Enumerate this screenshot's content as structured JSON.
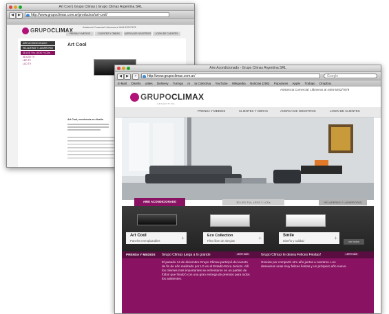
{
  "back_window": {
    "title": "Art Cool | Grupo Climax | Grupo Climax Argentina SRL",
    "url": "http://www.grupoclimax.com.ar/productos/art-cool/",
    "logo_prefix": "GRUPO",
    "logo_suffix": "CLIMAX",
    "nav": [
      "PRENSA Y MEDIOS",
      "CLIENTES Y OBRAS",
      "ACERCA DE NOSOTROS",
      "LOGIN DE CLIENTES"
    ],
    "phone": "Asistencia Comercial: Llámenos al 4464-5202/7678",
    "sidebar": [
      "AIRE ACONDICIONADO",
      "HELADERAS Y LAVARROPAS",
      "3D LED TVs, LEDS Y LCDs",
      "3D LED TV",
      "LED TV",
      "LCD TV"
    ],
    "product_title": "Art Cool",
    "product_subtitle": "Art Cool, excelencia en diseño"
  },
  "front_window": {
    "title": "Aire Acondicionado - Grupo Climax Argentina SRL",
    "url": "http://www.grupoclimax.com.ar/",
    "search_placeholder": "Google",
    "bookmarks": [
      "E-Mail",
      "Diseño",
      "utiles",
      "Delivery",
      "Turingo",
      "m",
      "la Colectiva",
      "YouTube",
      "Wikipedia",
      "Noticias (256)",
      "Populares",
      "Apple",
      "Trabajo",
      "Dropbox"
    ],
    "logo_prefix": "GRUPO",
    "logo_suffix": "CLIMAX",
    "logo_tagline": "ARGENTINA",
    "phone": "Asistencia Comercial: Llámenos al 4464-5202/7678",
    "nav": [
      "PRENSA Y MEDIOS",
      "CLIENTES Y OBRAS",
      "ACERCA DE NOSOTROS",
      "LOGIN DE CLIENTES"
    ],
    "category_tabs": [
      "AIRE ACONDICIONADO",
      "3D LED TVs, LEDS Y LCDs",
      "HELADERAS Y LAVARROPAS"
    ],
    "products": [
      {
        "name": "Art Cool",
        "desc": "Paneles reemplazables"
      },
      {
        "name": "Eco Collection",
        "desc": "Filtro libre de alergias"
      },
      {
        "name": "Smile",
        "desc": "Diseño y calidad"
      }
    ],
    "ver_todos": "ver todos",
    "news_section": "PRENSA Y MEDIOS",
    "news": [
      {
        "headline": "Grupo Climax juega a lo grande",
        "leer": "LEER MÁS",
        "body": "El pasado 14 de diciembre Grupo Climax participó del evento de fin de año realizado por LG en el Estadio Boca Juniors. Allí los clientes más importantes se enfrentaron en un partido de fútbol que finalizó con una gran entrega de premios para todos los asistentes."
      },
      {
        "headline": "Grupo Climax le desea Felices Fiestas!",
        "leer": "LEER MÁS",
        "body": "Gracias por compartir otro año juntos a nosotros. Les deseamos unas muy felices fiestas y un próspero año nuevo."
      }
    ]
  },
  "colors": {
    "brand": "#8a1262",
    "dark": "#2a2a2a"
  }
}
